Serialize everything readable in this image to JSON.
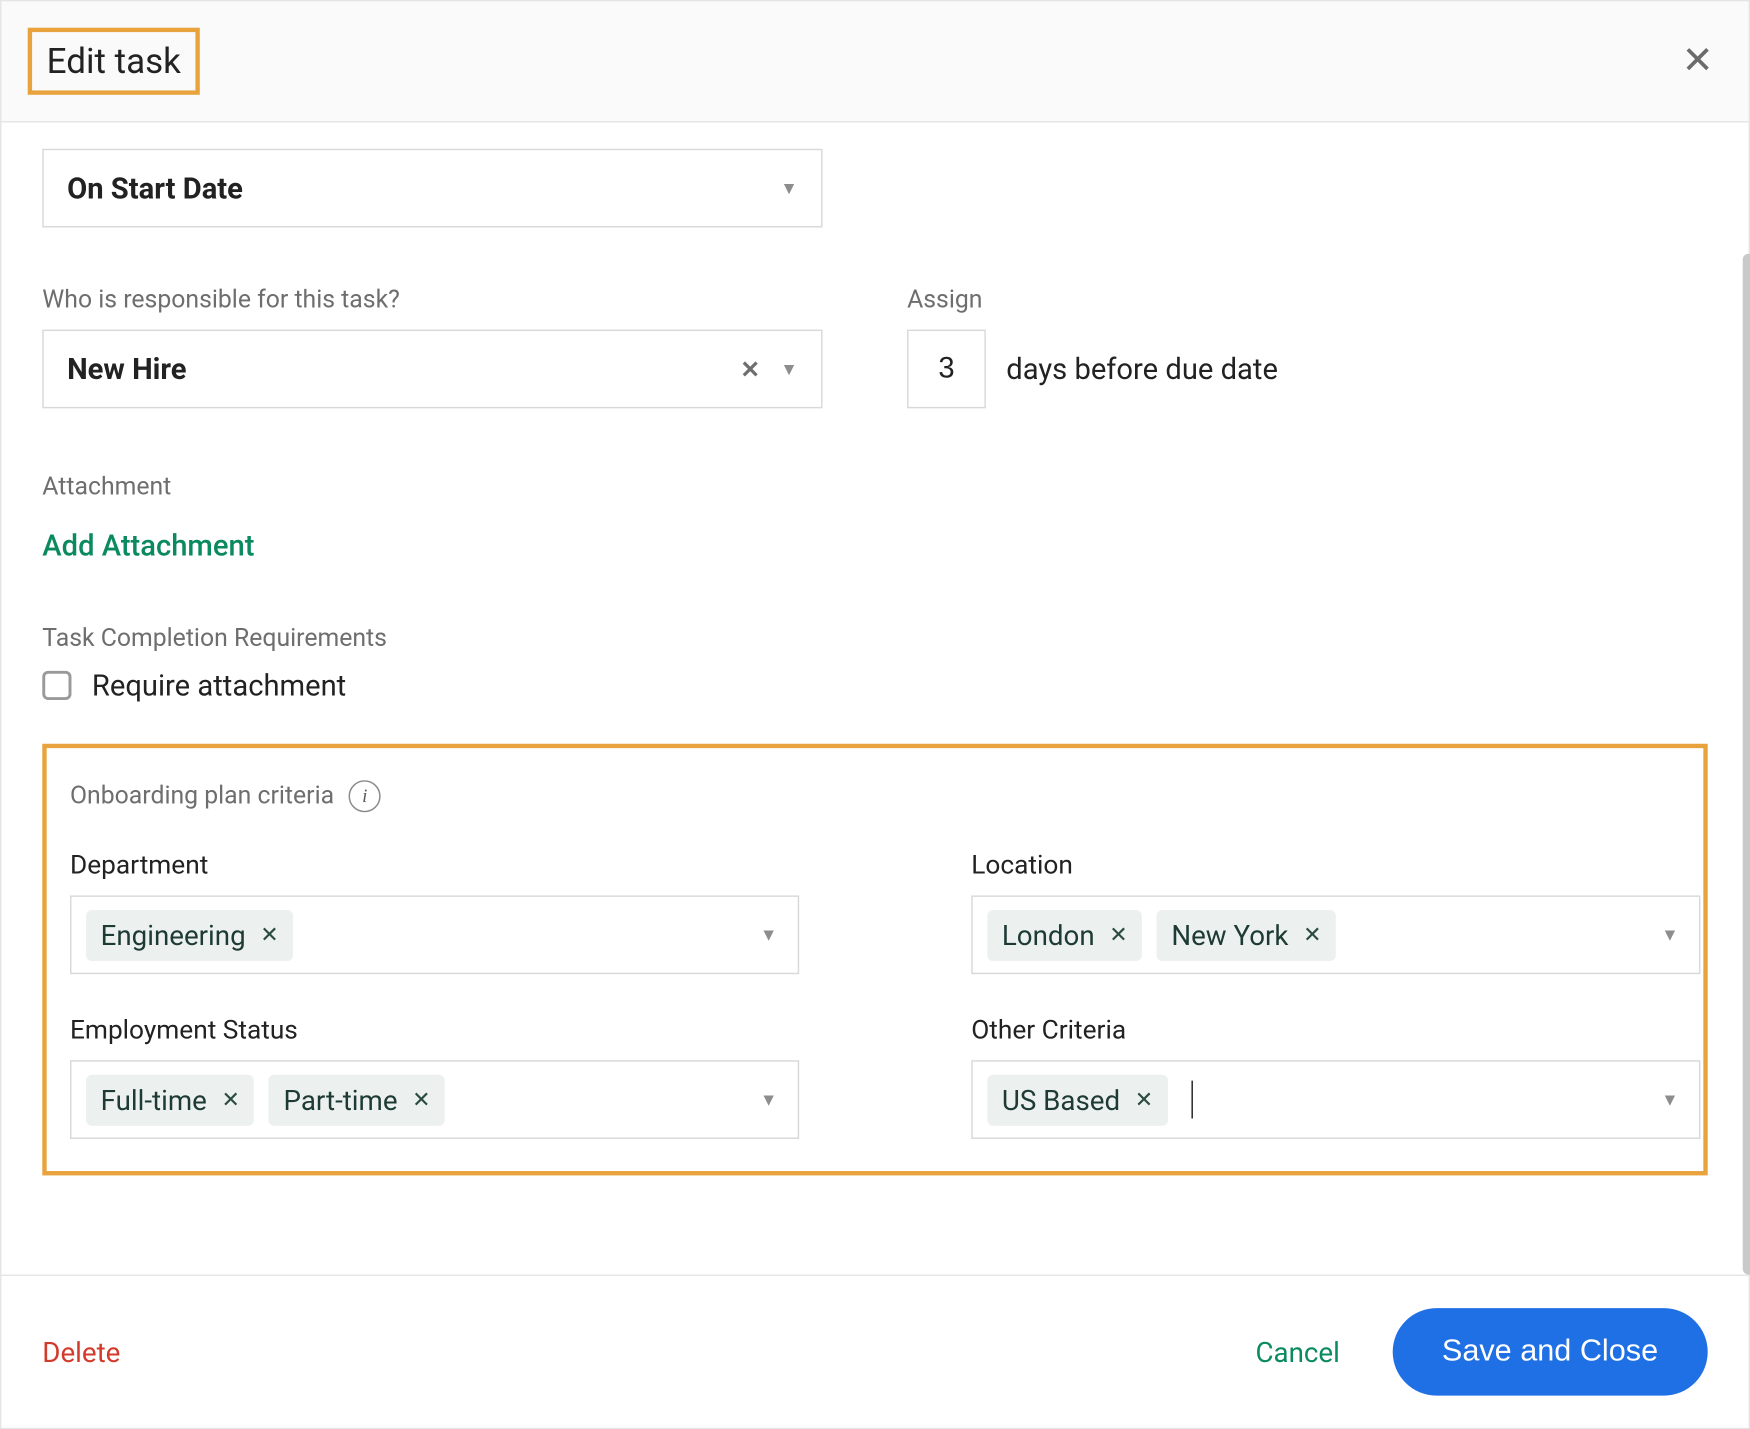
{
  "header": {
    "title": "Edit task"
  },
  "due": {
    "value": "On Start Date"
  },
  "responsible": {
    "label": "Who is responsible for this task?",
    "value": "New Hire"
  },
  "assign": {
    "label": "Assign",
    "value": "3",
    "suffix": "days before due date"
  },
  "attachment": {
    "label": "Attachment",
    "action": "Add Attachment"
  },
  "tcr": {
    "label": "Task Completion Requirements",
    "checkbox_label": "Require attachment"
  },
  "criteria": {
    "title": "Onboarding plan criteria",
    "department": {
      "label": "Department",
      "chips": [
        "Engineering"
      ]
    },
    "location": {
      "label": "Location",
      "chips": [
        "London",
        "New York"
      ]
    },
    "employment_status": {
      "label": "Employment Status",
      "chips": [
        "Full-time",
        "Part-time"
      ]
    },
    "other": {
      "label": "Other Criteria",
      "chips": [
        "US Based"
      ]
    }
  },
  "footer": {
    "delete": "Delete",
    "cancel": "Cancel",
    "save": "Save and Close"
  }
}
